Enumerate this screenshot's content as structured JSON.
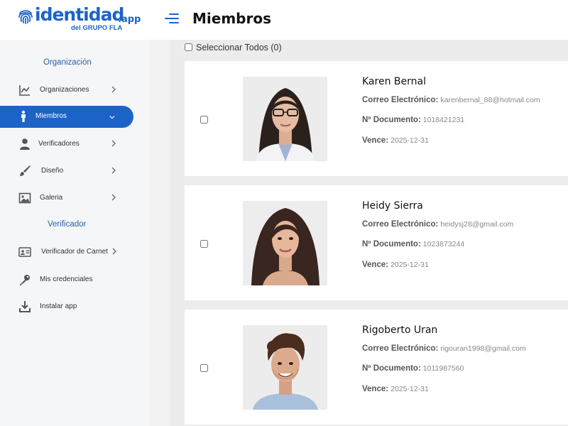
{
  "brand": {
    "name": "identidad",
    "suffix": ".app",
    "tagline": "del GRUPO FLA"
  },
  "page_title": "Miembros",
  "sidebar": {
    "section_org": "Organización",
    "section_verif": "Verificador",
    "items": [
      {
        "label": "Organizaciones",
        "icon": "chart-line-icon"
      },
      {
        "label": "Miembros",
        "icon": "person-icon"
      },
      {
        "label": "Verificadores",
        "icon": "user-icon"
      },
      {
        "label": "Diseño",
        "icon": "brush-icon"
      },
      {
        "label": "Galeria",
        "icon": "image-icon"
      },
      {
        "label": "Verificador de Carnet",
        "icon": "id-card-icon"
      },
      {
        "label": "Mis credenciales",
        "icon": "key-icon"
      },
      {
        "label": "Instalar app",
        "icon": "download-icon"
      }
    ]
  },
  "select_all_label": "Seleccionar Todos (0)",
  "field_labels": {
    "email": "Correo Electrónico:",
    "document": "Nº Documento:",
    "expires": "Vence:"
  },
  "members": [
    {
      "name": "Karen Bernal",
      "email": "karenbernal_88@hotmail.com",
      "document": "1018421231",
      "expires": "2025-12-31"
    },
    {
      "name": "Heidy Sierra",
      "email": "heidysj28@gmail.com",
      "document": "1023873244",
      "expires": "2025-12-31"
    },
    {
      "name": "Rigoberto Uran",
      "email": "rigouran1998@gmail.com",
      "document": "1011987560",
      "expires": "2025-12-31"
    }
  ],
  "colors": {
    "accent": "#1c63c7",
    "section": "#2c5fa8",
    "background": "#ececec"
  }
}
